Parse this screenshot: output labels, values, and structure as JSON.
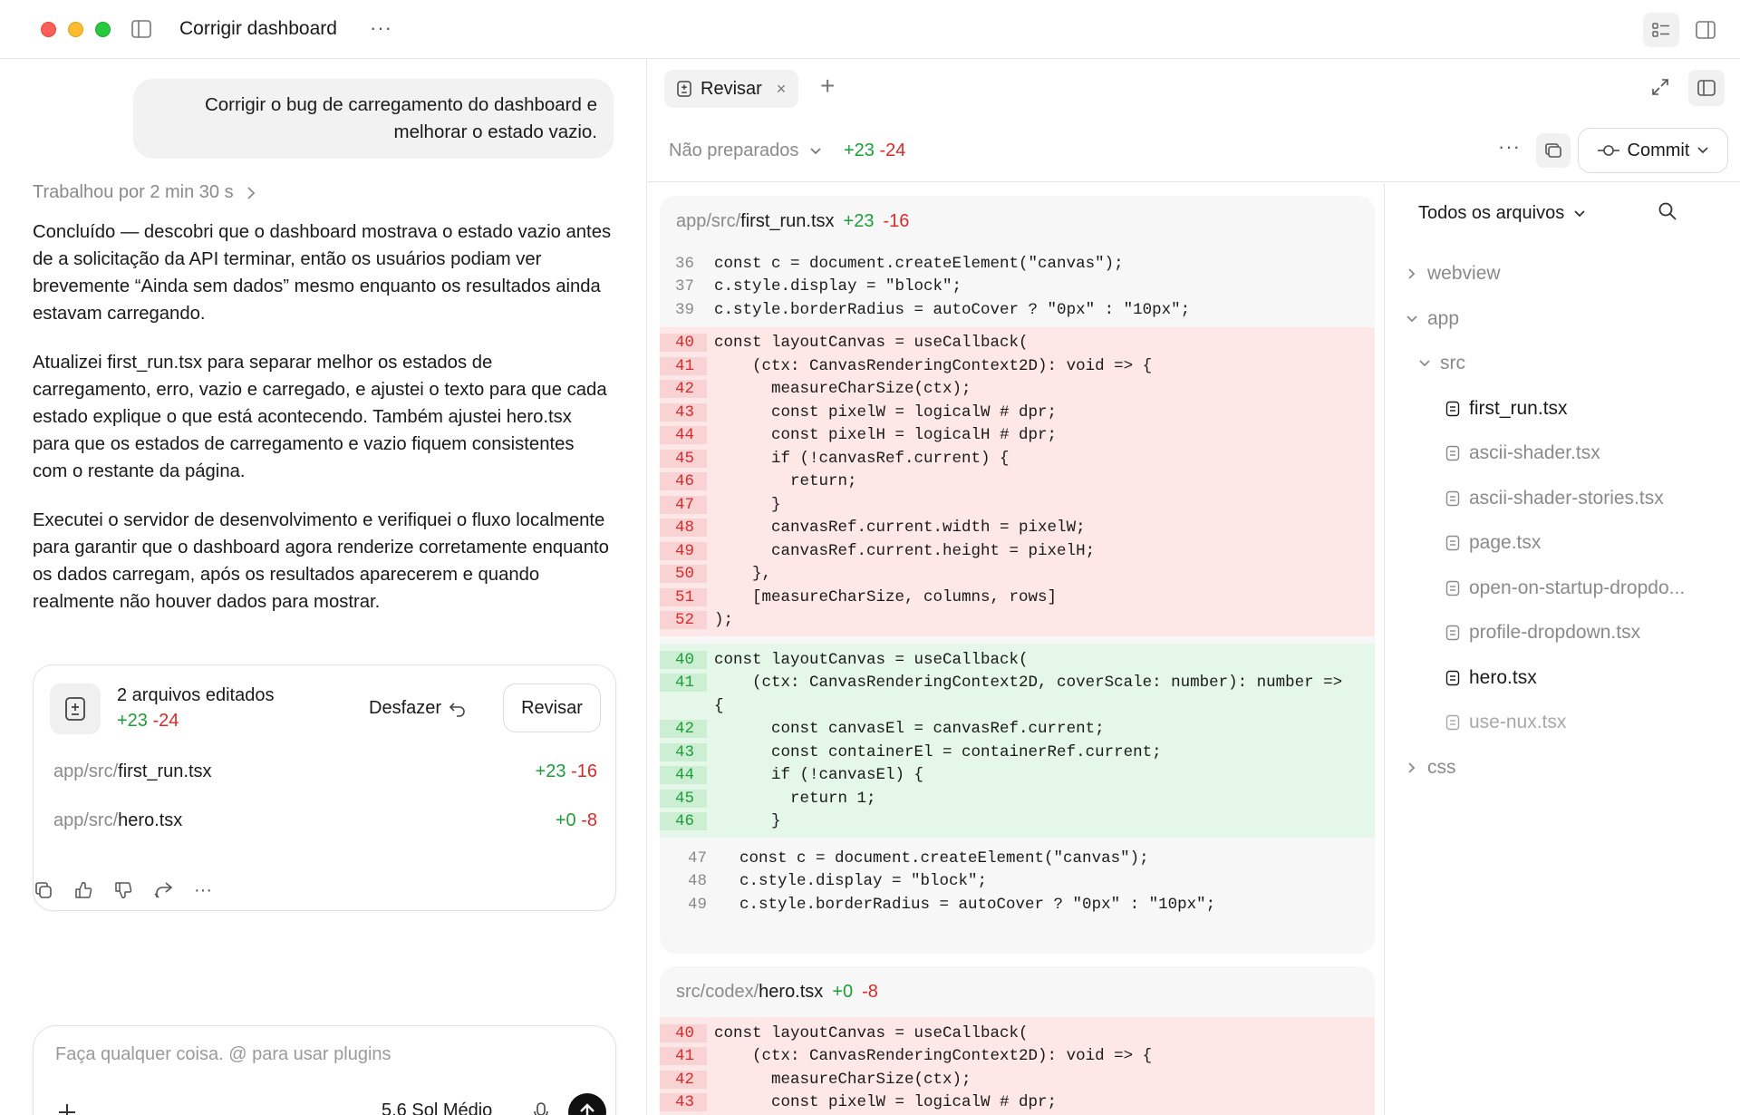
{
  "window": {
    "title": "Corrigir dashboard",
    "more_label": "···"
  },
  "chat": {
    "user_message": "Corrigir o bug de carregamento do dashboard e melhorar o estado vazio.",
    "worked_for": "Trabalhou por 2 min 30 s",
    "paragraphs": [
      "Concluído — descobri que o dashboard mostrava o estado vazio antes de a solicitação da API terminar, então os usuários podiam ver brevemente “Ainda sem dados” mesmo enquanto os resultados ainda estavam carregando.",
      "Atualizei first_run.tsx para separar melhor os estados de carregamento, erro, vazio e carregado, e ajustei o texto para que cada estado explique o que está acontecendo. Também ajustei hero.tsx para que os estados de carregamento e vazio fiquem consistentes com o restante da página.",
      "Executei o servidor de desenvolvimento e verifiquei o fluxo localmente para garantir que o dashboard agora renderize corretamente enquanto os dados carregam, após os resultados aparecerem e quando realmente não houver dados para mostrar."
    ],
    "edits": {
      "title": "2 arquivos editados",
      "added": "+23",
      "removed": "-24",
      "undo_label": "Desfazer",
      "review_label": "Revisar",
      "files": [
        {
          "dir": "app/src/",
          "name": "first_run.tsx",
          "added": "+23",
          "removed": "-16"
        },
        {
          "dir": "app/src/",
          "name": "hero.tsx",
          "added": "+0",
          "removed": "-8"
        }
      ]
    },
    "actions": [
      "copy-icon",
      "thumbs-up-icon",
      "thumbs-down-icon",
      "share-icon",
      "more-icon"
    ],
    "actions_more": "···",
    "composer": {
      "placeholder": "Faça qualquer coisa. @ para usar plugins",
      "model": "5.6 Sol Médio"
    }
  },
  "review": {
    "tab_label": "Revisar",
    "tab_close": "×",
    "tab_add": "+",
    "status_label": "Não preparados",
    "status_added": "+23",
    "status_removed": "-24",
    "more_label": "···",
    "commit_label": "Commit",
    "files": [
      {
        "dir": "app/src/",
        "name": "first_run.tsx",
        "added": "+23",
        "removed": "-16",
        "context_before": [
          {
            "n": "36",
            "code": "const c = document.createElement(\"canvas\");"
          },
          {
            "n": "37",
            "code": "c.style.display = \"block\";"
          },
          {
            "n": "39",
            "code": "c.style.borderRadius = autoCover ? \"0px\" : \"10px\";"
          }
        ],
        "removed_lines": [
          {
            "n": "40",
            "code": "const layoutCanvas = useCallback("
          },
          {
            "n": "41",
            "code": "    (ctx: CanvasRenderingContext2D): void => {"
          },
          {
            "n": "42",
            "code": "      measureCharSize(ctx);"
          },
          {
            "n": "43",
            "code": "      const pixelW = logicalW # dpr;"
          },
          {
            "n": "44",
            "code": "      const pixelH = logicalH # dpr;"
          },
          {
            "n": "45",
            "code": "      if (!canvasRef.current) {"
          },
          {
            "n": "46",
            "code": "        return;"
          },
          {
            "n": "47",
            "code": "      }"
          },
          {
            "n": "48",
            "code": "      canvasRef.current.width = pixelW;"
          },
          {
            "n": "49",
            "code": "      canvasRef.current.height = pixelH;"
          },
          {
            "n": "50",
            "code": "    },"
          },
          {
            "n": "51",
            "code": "    [measureCharSize, columns, rows]"
          },
          {
            "n": "52",
            "code": ");"
          }
        ],
        "added_lines": [
          {
            "n": "40",
            "code": "const layoutCanvas = useCallback("
          },
          {
            "n": "41",
            "code": "    (ctx: CanvasRenderingContext2D, coverScale: number): number =>"
          },
          {
            "n": "",
            "code": "{"
          },
          {
            "n": "42",
            "code": "      const canvasEl = canvasRef.current;"
          },
          {
            "n": "43",
            "code": "      const containerEl = containerRef.current;"
          },
          {
            "n": "44",
            "code": "      if (!canvasEl) {"
          },
          {
            "n": "45",
            "code": "        return 1;"
          },
          {
            "n": "46",
            "code": "      }"
          }
        ],
        "context_after": [
          {
            "n": "47",
            "code": "const c = document.createElement(\"canvas\");"
          },
          {
            "n": "48",
            "code": "c.style.display = \"block\";"
          },
          {
            "n": "49",
            "code": "c.style.borderRadius = autoCover ? \"0px\" : \"10px\";"
          }
        ]
      },
      {
        "dir": "src/codex/",
        "name": "hero.tsx",
        "added": "+0",
        "removed": "-8",
        "removed_lines": [
          {
            "n": "40",
            "code": "const layoutCanvas = useCallback("
          },
          {
            "n": "41",
            "code": "    (ctx: CanvasRenderingContext2D): void => {"
          },
          {
            "n": "42",
            "code": "      measureCharSize(ctx);"
          },
          {
            "n": "43",
            "code": "      const pixelW = logicalW # dpr;"
          }
        ]
      }
    ],
    "tree": {
      "header": "Todos os arquivos",
      "items": [
        {
          "kind": "folder",
          "label": "webview",
          "open": false
        },
        {
          "kind": "folder",
          "label": "app",
          "open": true
        },
        {
          "kind": "folder",
          "label": "src",
          "open": true
        },
        {
          "kind": "file",
          "label": "first_run.tsx",
          "state": "bright"
        },
        {
          "kind": "file",
          "label": "ascii-shader.tsx",
          "state": "dim"
        },
        {
          "kind": "file",
          "label": "ascii-shader-stories.tsx",
          "state": "dim"
        },
        {
          "kind": "file",
          "label": "page.tsx",
          "state": "dim"
        },
        {
          "kind": "file",
          "label": "open-on-startup-dropdo...",
          "state": "dim"
        },
        {
          "kind": "file",
          "label": "profile-dropdown.tsx",
          "state": "dim"
        },
        {
          "kind": "file",
          "label": "hero.tsx",
          "state": "bright"
        },
        {
          "kind": "file",
          "label": "use-nux.tsx",
          "state": "faint"
        },
        {
          "kind": "folder",
          "label": "css",
          "open": false
        }
      ]
    }
  },
  "colors": {
    "added": "#1f9d3a",
    "removed": "#d72b2b",
    "removed_bg": "#fde7e7",
    "added_bg": "#e5f7e9"
  }
}
